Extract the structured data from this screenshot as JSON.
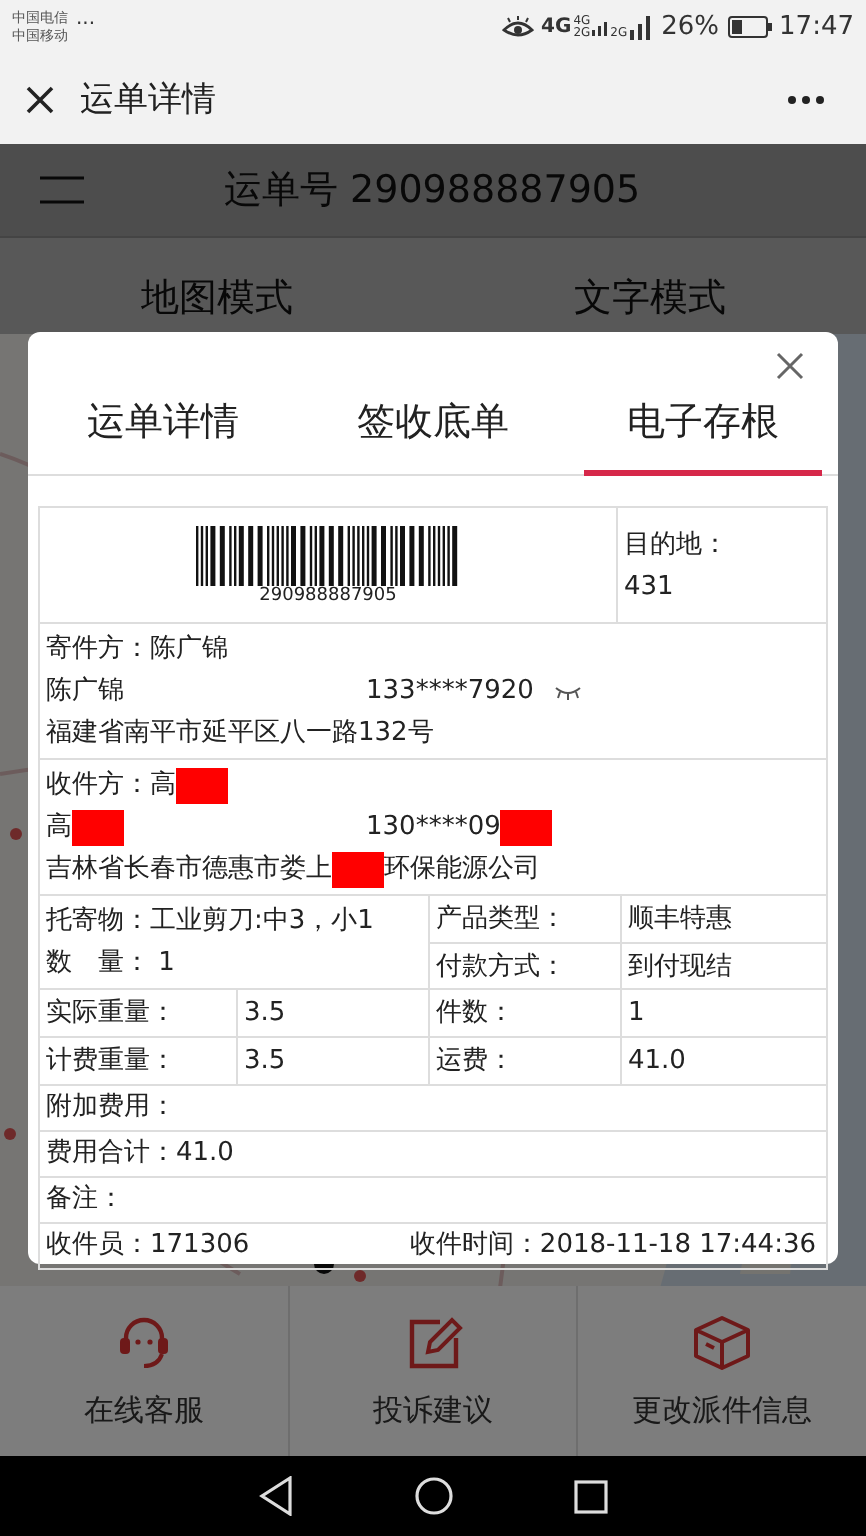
{
  "status_bar": {
    "carriers": [
      "中国电信",
      "中国移动"
    ],
    "more": "...",
    "network_labels": [
      "4G",
      "4G",
      "2G",
      "2G"
    ],
    "battery": "26%",
    "time": "17:47"
  },
  "header": {
    "title": "运单详情"
  },
  "app": {
    "waybill_title": "运单号 290988887905",
    "modes": [
      {
        "label": "地图模式"
      },
      {
        "label": "文字模式"
      }
    ],
    "actions": [
      {
        "kind": "headset",
        "label": "在线客服"
      },
      {
        "kind": "edit",
        "label": "投诉建议"
      },
      {
        "kind": "box",
        "label": "更改派件信息"
      }
    ]
  },
  "modal": {
    "tabs": [
      {
        "label": "运单详情",
        "selected": false
      },
      {
        "label": "签收底单",
        "selected": false
      },
      {
        "label": "电子存根",
        "selected": true
      }
    ],
    "barcode_number": "290988887905",
    "destination": {
      "label": "目的地：",
      "value": "431"
    },
    "parties": [
      {
        "kind": "sender",
        "title": [
          {
            "kind": "text",
            "text": "寄件方：陈广锦"
          }
        ],
        "name": [
          {
            "kind": "text",
            "text": "陈广锦"
          }
        ],
        "phone": [
          {
            "kind": "text",
            "text": "133****7920"
          }
        ],
        "address": [
          {
            "kind": "text",
            "text": "福建省南平市延平区八一路132号"
          }
        ]
      },
      {
        "kind": "recipient",
        "title": [
          {
            "kind": "text",
            "text": "收件方：高"
          },
          {
            "kind": "redaction"
          }
        ],
        "name": [
          {
            "kind": "text",
            "text": "高"
          },
          {
            "kind": "redaction"
          }
        ],
        "phone": [
          {
            "kind": "text",
            "text": "130****09"
          },
          {
            "kind": "redaction"
          }
        ],
        "address": [
          {
            "kind": "text",
            "text": "吉林省长春市德惠市娄上"
          },
          {
            "kind": "redaction"
          },
          {
            "kind": "text",
            "text": "环保能源公司"
          }
        ]
      }
    ],
    "goods": {
      "items": [
        "托寄物：工业剪刀:中3，小1",
        "数　量：  1"
      ],
      "details": [
        [
          "产品类型：",
          "顺丰特惠"
        ],
        [
          "付款方式：",
          "到付现结"
        ]
      ]
    },
    "weights": [
      [
        "实际重量：",
        "3.5",
        "件数：",
        "1"
      ],
      [
        "计费重量：",
        "3.5",
        "运费：",
        "41.0"
      ]
    ],
    "lines": [
      "附加费用：",
      "费用合计：41.0",
      "备注："
    ],
    "footer": [
      "收件员：171306",
      "收件时间：2018-11-18 17:44:36"
    ]
  }
}
